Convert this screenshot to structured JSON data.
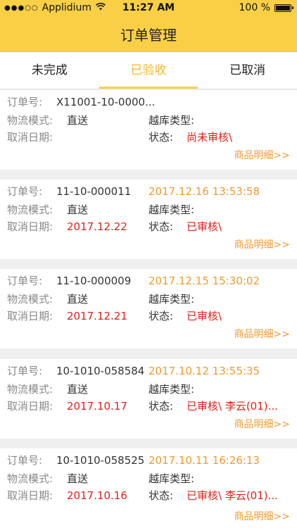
{
  "status_bar": {
    "carrier": "Applidium",
    "time": "11:27 AM",
    "battery": "100 %",
    "battery_level": 1.0
  },
  "nav": {
    "title": "订单管理"
  },
  "tabs": [
    {
      "label": "未完成"
    },
    {
      "label": "已验收"
    },
    {
      "label": "已取消"
    }
  ],
  "labels": {
    "order_no": "订单号:",
    "logistics": "物流模式:",
    "warehouse_type": "越库类型:",
    "cancel_date": "取消日期:",
    "status": "状态:",
    "detail_link": "商品明细>>"
  },
  "orders": [
    {
      "order_no": "X11001-10-0000...",
      "timestamp": "",
      "logistics": "直送",
      "warehouse_type": "",
      "cancel_date": "",
      "status": "尚未审核\\"
    },
    {
      "order_no": "11-10-000011",
      "timestamp": "2017.12.16 13:53:58",
      "logistics": "直送",
      "warehouse_type": "",
      "cancel_date": "2017.12.22",
      "status": "已审核\\"
    },
    {
      "order_no": "11-10-000009",
      "timestamp": "2017.12.15 15:30:02",
      "logistics": "直送",
      "warehouse_type": "",
      "cancel_date": "2017.12.21",
      "status": "已审核\\"
    },
    {
      "order_no": "10-1010-058584",
      "timestamp": "2017.10.12 13:55:35",
      "logistics": "直送",
      "warehouse_type": "",
      "cancel_date": "2017.10.17",
      "status": "已审核\\ 李云(01)..."
    },
    {
      "order_no": "10-1010-058525",
      "timestamp": "2017.10.11 16:26:13",
      "logistics": "直送",
      "warehouse_type": "",
      "cancel_date": "2017.10.16",
      "status": "已审核\\ 李云(01)..."
    }
  ]
}
